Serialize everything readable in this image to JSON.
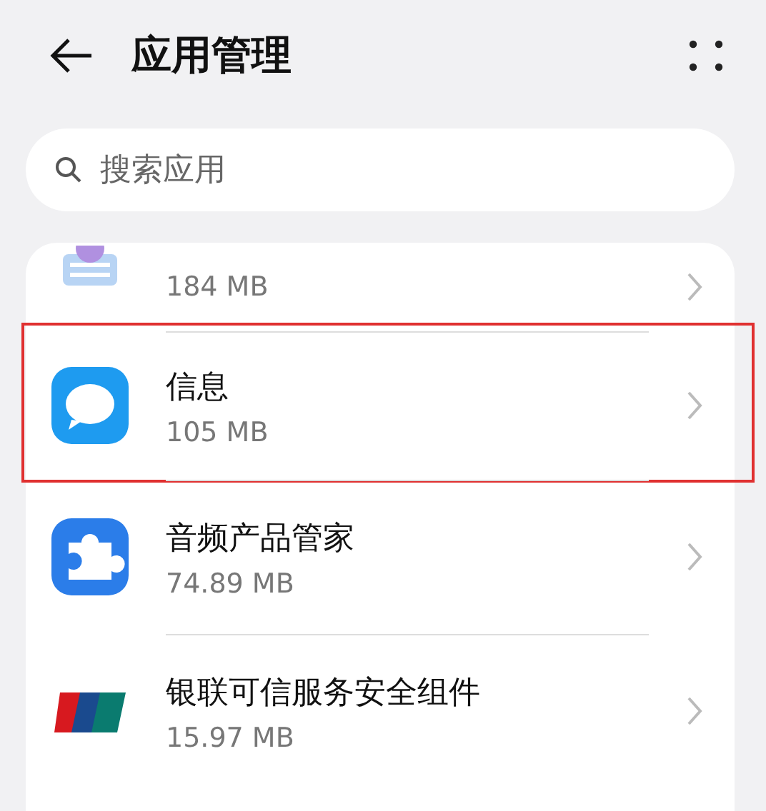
{
  "header": {
    "title": "应用管理"
  },
  "search": {
    "placeholder": "搜索应用"
  },
  "apps": [
    {
      "kind": "keyboard",
      "size": "184 MB",
      "highlighted": false
    },
    {
      "kind": "message",
      "name": "信息",
      "size": "105 MB",
      "highlighted": true
    },
    {
      "kind": "puzzle",
      "name": "音频产品管家",
      "size": "74.89 MB",
      "highlighted": false
    },
    {
      "kind": "card",
      "name": "银联可信服务安全组件",
      "size": "15.97 MB",
      "highlighted": false
    }
  ]
}
